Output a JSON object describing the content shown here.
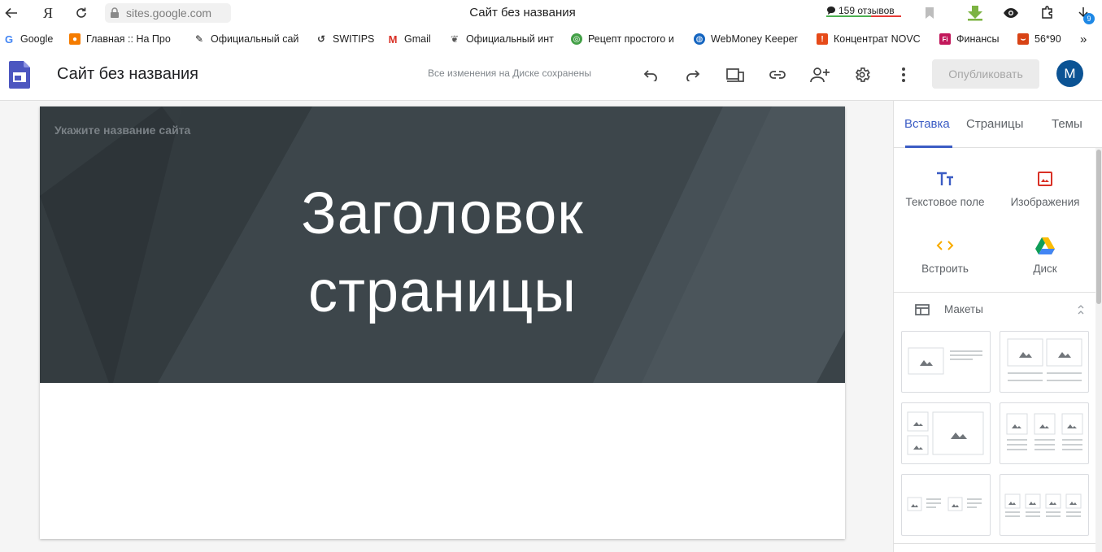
{
  "browser": {
    "yandex_glyph": "Я",
    "url": "sites.google.com",
    "window_title": "Сайт без названия",
    "reviews": "159 отзывов",
    "downloads_badge": "9"
  },
  "bookmarks": [
    {
      "label": "Google",
      "icon": "google-icon",
      "color": "#4285f4"
    },
    {
      "label": "Главная :: На Про",
      "icon": "fire-icon",
      "color": "#f57c00"
    },
    {
      "label": "Официальный сай",
      "icon": "brand-icon",
      "color": "#111111"
    },
    {
      "label": "SWITIPS",
      "icon": "switips-icon",
      "color": "#333333"
    },
    {
      "label": "Gmail",
      "icon": "gmail-icon",
      "color": "#d93025"
    },
    {
      "label": "Официальный инт",
      "icon": "leaf-icon",
      "color": "#555555"
    },
    {
      "label": "Рецепт простого и",
      "icon": "recipe-icon",
      "color": "#43a047"
    },
    {
      "label": "WebMoney Keeper",
      "icon": "globe-icon",
      "color": "#1565c0"
    },
    {
      "label": "Концентрат NOVC",
      "icon": "novc-icon",
      "color": "#e64a19"
    },
    {
      "label": "Финансы",
      "icon": "finance-icon",
      "color": "#c2185b"
    },
    {
      "label": "56*90",
      "icon": "shield-icon",
      "color": "#d84315"
    }
  ],
  "bookmarks_more": "»",
  "appbar": {
    "title": "Сайт без названия",
    "saved_status": "Все изменения на Диске сохранены",
    "publish_label": "Опубликовать",
    "avatar_letter": "M",
    "accent": "#0b5394"
  },
  "page": {
    "site_name_placeholder": "Укажите название сайта",
    "heading_line1": "Заголовок",
    "heading_line2": "страницы"
  },
  "panel": {
    "tabs": [
      "Вставка",
      "Страницы",
      "Темы"
    ],
    "active_tab": "Вставка",
    "insert_items": [
      {
        "label": "Текстовое поле",
        "icon": "text-box-icon"
      },
      {
        "label": "Изображения",
        "icon": "image-icon"
      },
      {
        "label": "Встроить",
        "icon": "embed-icon"
      },
      {
        "label": "Диск",
        "icon": "google-drive-icon"
      }
    ],
    "layouts_label": "Макеты",
    "accent": "#3b5cc4"
  }
}
